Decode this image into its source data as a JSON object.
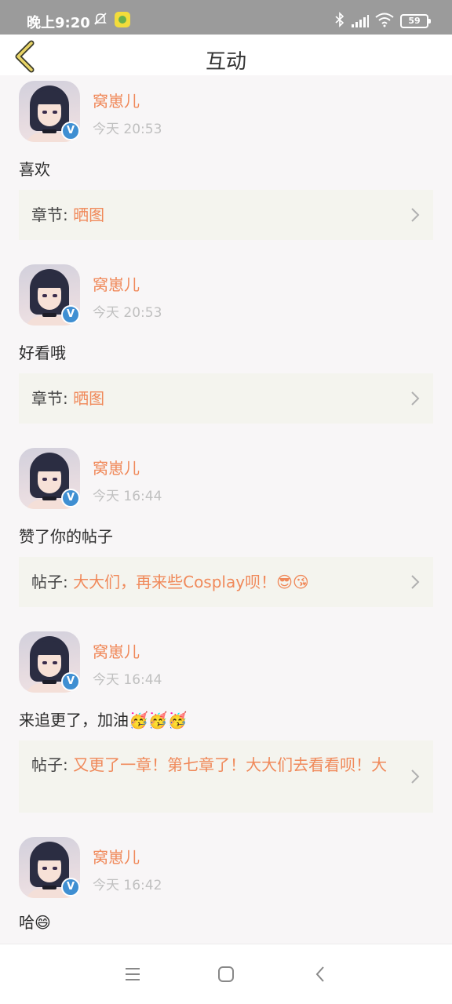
{
  "status_bar": {
    "time": "晚上9:20",
    "battery": "59",
    "icons": [
      "bell-muted-icon",
      "app-notification-icon",
      "bluetooth-icon",
      "signal-icon",
      "wifi-icon",
      "battery-icon"
    ]
  },
  "header": {
    "title": "互动",
    "back_icon": "chevron-left-icon"
  },
  "colors": {
    "accent": "#f0895a",
    "card_bg": "#f4f4ee",
    "page_bg": "#f8f6f7",
    "verified": "#3f8fd2"
  },
  "items": [
    {
      "username": "窝崽儿",
      "time": "今天 20:53",
      "content": "喜欢",
      "ref_label": "章节:",
      "ref_value": "晒图"
    },
    {
      "username": "窝崽儿",
      "time": "今天 20:53",
      "content": "好看哦",
      "ref_label": "章节:",
      "ref_value": "晒图"
    },
    {
      "username": "窝崽儿",
      "time": "今天 16:44",
      "content": "赞了你的帖子",
      "ref_label": "帖子:",
      "ref_value": "大大们，再来些Cosplay呗！😎😘"
    },
    {
      "username": "窝崽儿",
      "time": "今天 16:44",
      "content": "来追更了，加油🥳🥳🥳",
      "ref_label": "帖子:",
      "ref_value": "又更了一章！第七章了！大大们去看看呗！大"
    },
    {
      "username": "窝崽儿",
      "time": "今天 16:42",
      "content": "哈😄"
    }
  ],
  "nav_bar": {
    "icons": [
      "menu-icon",
      "home-icon",
      "back-icon"
    ]
  }
}
